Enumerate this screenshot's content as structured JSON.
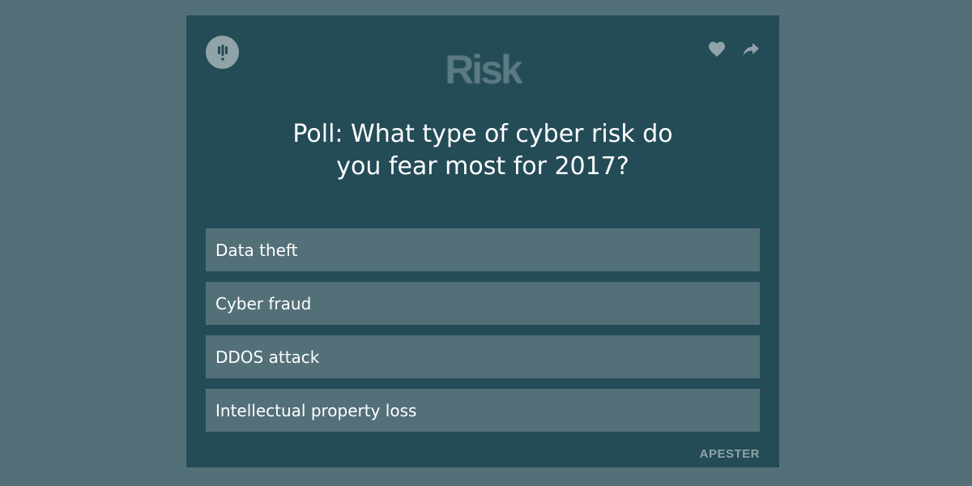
{
  "header": {
    "brand": "Risk"
  },
  "poll": {
    "question": "Poll: What type of cyber risk do you fear most for 2017?",
    "options": [
      {
        "label": "Data theft"
      },
      {
        "label": "Cyber fraud"
      },
      {
        "label": "DDOS attack"
      },
      {
        "label": "Intellectual property loss"
      }
    ]
  },
  "footer": {
    "brand": "APESTER"
  },
  "icons": {
    "badge": "apester-logo-icon",
    "like": "heart-icon",
    "share": "share-icon"
  },
  "colors": {
    "background": "#537079",
    "card": "#244c57",
    "option": "#537079",
    "muted": "#8fa3a8"
  }
}
